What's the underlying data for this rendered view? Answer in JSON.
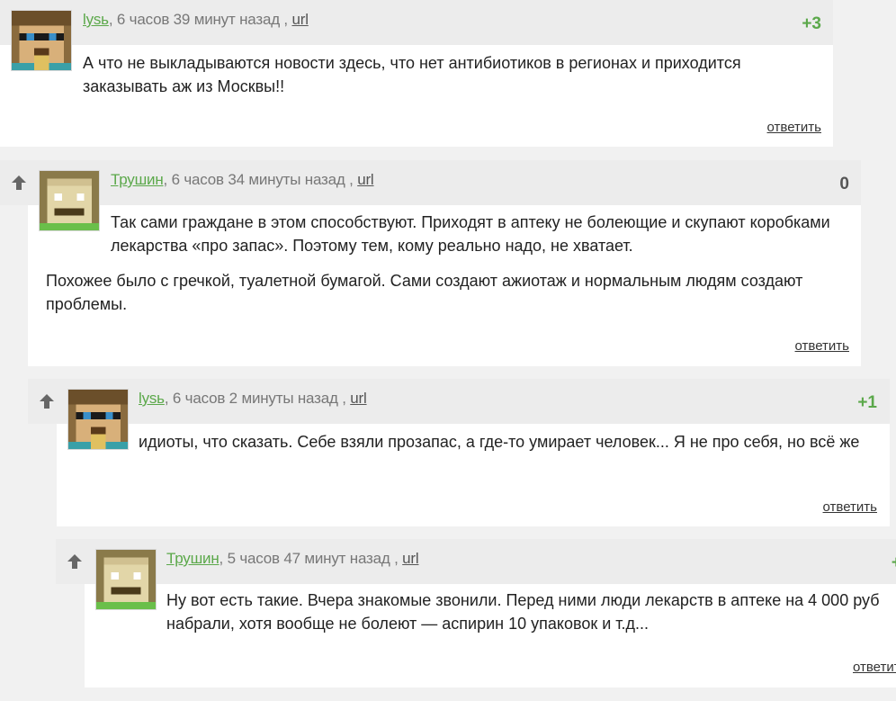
{
  "comments": [
    {
      "author": "lysь",
      "time": ", 6 часов 39 минут назад , ",
      "url_label": "url",
      "score": "+3",
      "paragraphs": [
        "А что не выкладываются новости здесь, что нет антибиотиков в регионах и приходится заказывать аж из Москвы!!"
      ],
      "reply_label": "ответить",
      "avatar": "sunglasses-avatar"
    },
    {
      "author": "Трушин",
      "time": ", 6 часов 34 минуты назад , ",
      "url_label": "url",
      "score": "0",
      "paragraphs": [
        "Так сами граждане в этом способствуют. Приходят в аптеку не болеющие и скупают коробками лекарства «про запас». Поэтому тем, кому реально надо, не хватает.",
        "Похожее было с гречкой, туалетной бумагой. Сами создают ажиотаж и нормальным людям создают проблемы."
      ],
      "reply_label": "ответить",
      "avatar": "bald-mustache-avatar"
    },
    {
      "author": "lysь",
      "time": ", 6 часов 2 минуты назад , ",
      "url_label": "url",
      "score": "+1",
      "paragraphs": [
        "идиоты, что сказать. Себе взяли прозапас, а где-то умирает человек... Я не про себя, но всё же"
      ],
      "reply_label": "ответить",
      "avatar": "sunglasses-avatar"
    },
    {
      "author": "Трушин",
      "time": ", 5 часов 47 минут назад , ",
      "url_label": "url",
      "score": "+",
      "paragraphs": [
        "Ну вот есть такие. Вчера знакомые звонили. Перед ними люди лекарств в аптеке на 4 000 руб набрали, хотя вообще не болеют — аспирин 10 упаковок и т.д..."
      ],
      "reply_label": "ответит",
      "avatar": "bald-mustache-avatar"
    }
  ],
  "colors": {
    "author": "#5ba84a",
    "score_positive": "#5ba84a",
    "header_bg": "#ececec",
    "body_bg": "#ffffff"
  }
}
